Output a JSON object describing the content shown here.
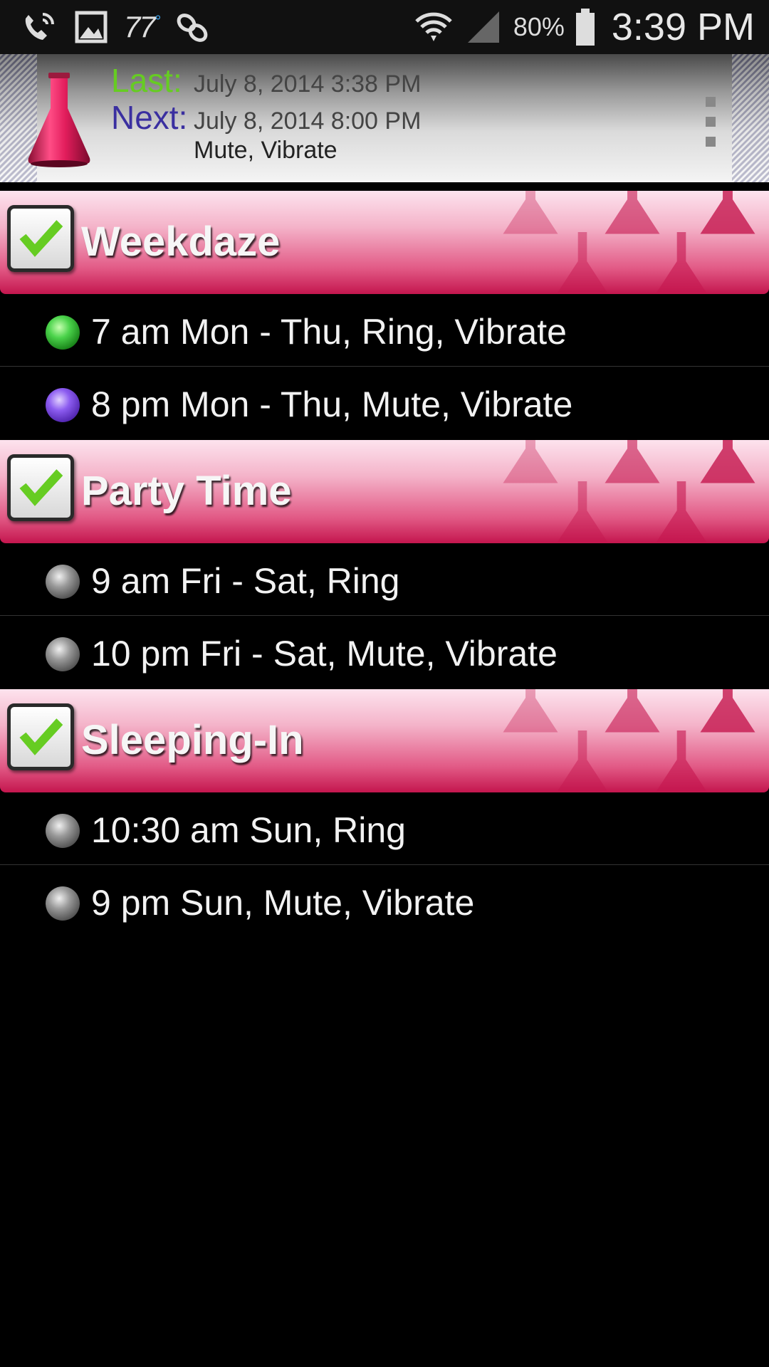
{
  "status_bar": {
    "temperature": "77",
    "degree_symbol": "°",
    "battery_percent": "80%",
    "clock": "3:39 PM",
    "icons": [
      "wifi-calling-icon",
      "gallery-icon",
      "weather-icon",
      "link-icon",
      "wifi-icon",
      "signal-icon",
      "battery-icon"
    ]
  },
  "header": {
    "last_label": "Last:",
    "last_value": "July 8, 2014 3:38 PM",
    "next_label": "Next:",
    "next_value": "July 8, 2014 8:00 PM",
    "next_actions": "Mute, Vibrate",
    "logo_icon": "flask-icon",
    "menu_icon": "overflow-menu-icon"
  },
  "colors": {
    "last_label": "#66cc22",
    "next_label": "#3a2fa0",
    "group_header": "#c4164e",
    "checkmark": "#66cc22",
    "dot_active": "#4bd34b",
    "dot_next": "#8c5cf0",
    "dot_inactive": "#9a9a9a"
  },
  "groups": [
    {
      "title": "Weekdaze",
      "checked": true,
      "events": [
        {
          "text": "7 am Mon - Thu, Ring, Vibrate",
          "status": "active"
        },
        {
          "text": "8 pm Mon - Thu, Mute, Vibrate",
          "status": "next"
        }
      ]
    },
    {
      "title": "Party Time",
      "checked": true,
      "events": [
        {
          "text": "9 am Fri - Sat, Ring",
          "status": "inactive"
        },
        {
          "text": "10 pm Fri - Sat, Mute, Vibrate",
          "status": "inactive"
        }
      ]
    },
    {
      "title": "Sleeping-In",
      "checked": true,
      "events": [
        {
          "text": "10:30 am Sun, Ring",
          "status": "inactive"
        },
        {
          "text": "9 pm Sun, Mute, Vibrate",
          "status": "inactive"
        }
      ]
    }
  ]
}
